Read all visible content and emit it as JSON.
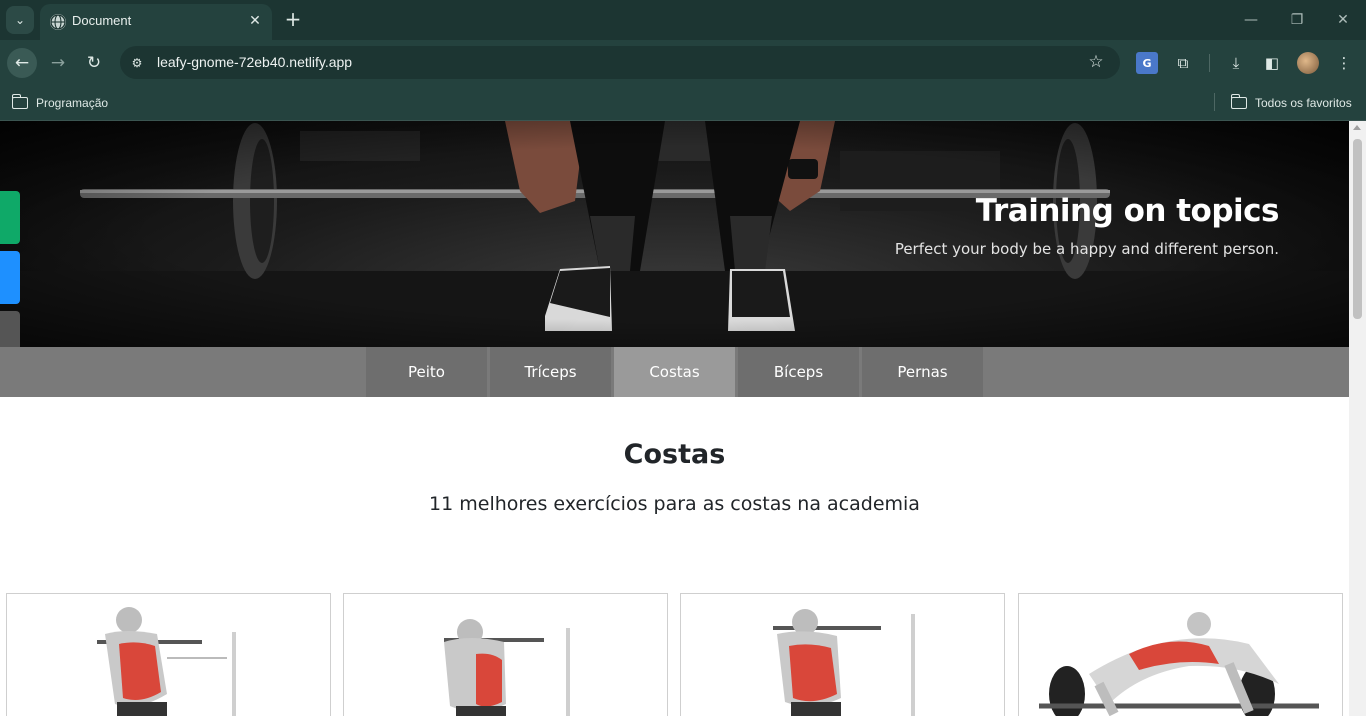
{
  "browser": {
    "tab_title": "Document",
    "url": "leafy-gnome-72eb40.netlify.app",
    "bookmarks": [
      {
        "label": "Programação",
        "icon": "folder-icon"
      },
      {
        "label": "Todos os favoritos",
        "icon": "folder-icon"
      }
    ],
    "accent_color": "#1c3532"
  },
  "hero": {
    "title": "Training on topics",
    "subtitle": "Perfect your body be a happy and different person."
  },
  "side_buttons": [
    {
      "color": "#0fa968",
      "icon": "whatsapp-icon"
    },
    {
      "color": "#1e90ff",
      "icon": "facebook-icon"
    },
    {
      "color": "#555555",
      "icon": "share-icon"
    }
  ],
  "topics": [
    {
      "label": "Peito",
      "active": false
    },
    {
      "label": "Tríceps",
      "active": false
    },
    {
      "label": "Costas",
      "active": true
    },
    {
      "label": "Bíceps",
      "active": false
    },
    {
      "label": "Pernas",
      "active": false
    }
  ],
  "section": {
    "title": "Costas",
    "subtitle": "11 melhores exercícios para as costas na academia"
  },
  "cards": [
    {
      "image": "pull-up-illustration"
    },
    {
      "image": "pull-up-illustration"
    },
    {
      "image": "pull-up-illustration"
    },
    {
      "image": "barbell-row-illustration"
    }
  ]
}
